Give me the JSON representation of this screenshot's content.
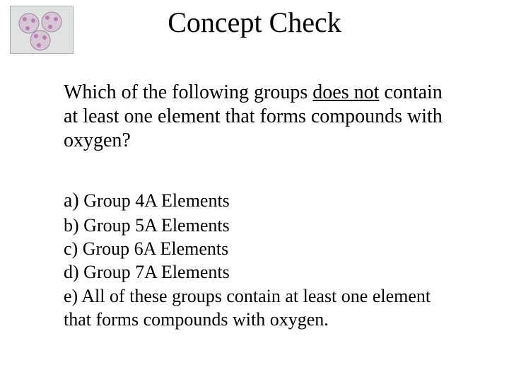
{
  "title": "Concept Check",
  "question": {
    "pre": "Which of the following groups ",
    "underlined": "does not",
    "post": " contain at least one element that forms compounds with oxygen?"
  },
  "options": {
    "a": {
      "marker": "a)",
      "text": " Group 4A Elements"
    },
    "b": {
      "marker": "b)",
      "text": "  Group 5A Elements"
    },
    "c": {
      "marker": "c)",
      "text": "  Group 6A Elements"
    },
    "d": {
      "marker": "d)",
      "text": "  Group 7A Elements"
    },
    "e": {
      "marker": "e)",
      "text": "  All of these groups contain at least one element that forms compounds with oxygen."
    }
  }
}
